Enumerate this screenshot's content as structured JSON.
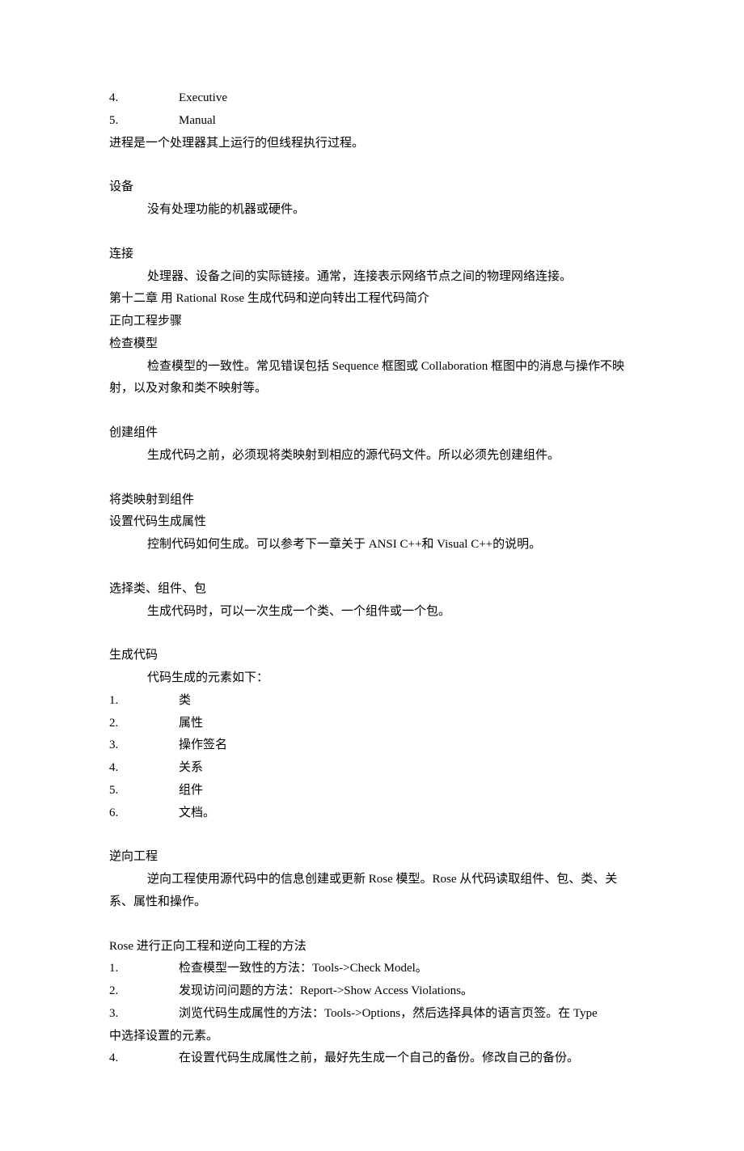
{
  "topList": [
    {
      "num": "4.",
      "text": "Executive"
    },
    {
      "num": "5.",
      "text": "Manual"
    }
  ],
  "line_process": "进程是一个处理器其上运行的但线程执行过程。",
  "h_device": "设备",
  "p_device": "没有处理功能的机器或硬件。",
  "h_connection": "连接",
  "p_connection": "处理器、设备之间的实际链接。通常，连接表示网络节点之间的物理网络连接。",
  "ch12_title": "第十二章  用 Rational Rose 生成代码和逆向转出工程代码简介",
  "h_forward": "正向工程步骤",
  "h_check": "检查模型",
  "p_check": "检查模型的一致性。常见错误包括 Sequence 框图或 Collaboration 框图中的消息与操作不映射，以及对象和类不映射等。",
  "h_create": "创建组件",
  "p_create": "生成代码之前，必须现将类映射到相应的源代码文件。所以必须先创建组件。",
  "h_map": "将类映射到组件",
  "h_setprop": "设置代码生成属性",
  "p_setprop": "控制代码如何生成。可以参考下一章关于 ANSI C++和 Visual C++的说明。",
  "h_select": "选择类、组件、包",
  "p_select": "生成代码时，可以一次生成一个类、一个组件或一个包。",
  "h_generate": "生成代码",
  "p_generate": "代码生成的元素如下：",
  "genList": [
    {
      "num": "1.",
      "text": "类"
    },
    {
      "num": "2.",
      "text": "属性"
    },
    {
      "num": "3.",
      "text": "操作签名"
    },
    {
      "num": "4.",
      "text": "关系"
    },
    {
      "num": "5.",
      "text": "组件"
    },
    {
      "num": "6.",
      "text": "文档。"
    }
  ],
  "h_reverse": "逆向工程",
  "p_reverse": "逆向工程使用源代码中的信息创建或更新 Rose 模型。Rose 从代码读取组件、包、类、关系、属性和操作。",
  "h_methods": "Rose 进行正向工程和逆向工程的方法",
  "methodList": [
    {
      "num": "1.",
      "text": "检查模型一致性的方法：Tools->Check Model。"
    },
    {
      "num": "2.",
      "text": "发现访问问题的方法：Report->Show Access Violations。"
    },
    {
      "num": "3.",
      "text": "浏览代码生成属性的方法：Tools->Options，然后选择具体的语言页签。在 Type"
    }
  ],
  "method3_cont": "中选择设置的元素。",
  "method4": {
    "num": "4.",
    "text": "在设置代码生成属性之前，最好先生成一个自己的备份。修改自己的备份。"
  }
}
